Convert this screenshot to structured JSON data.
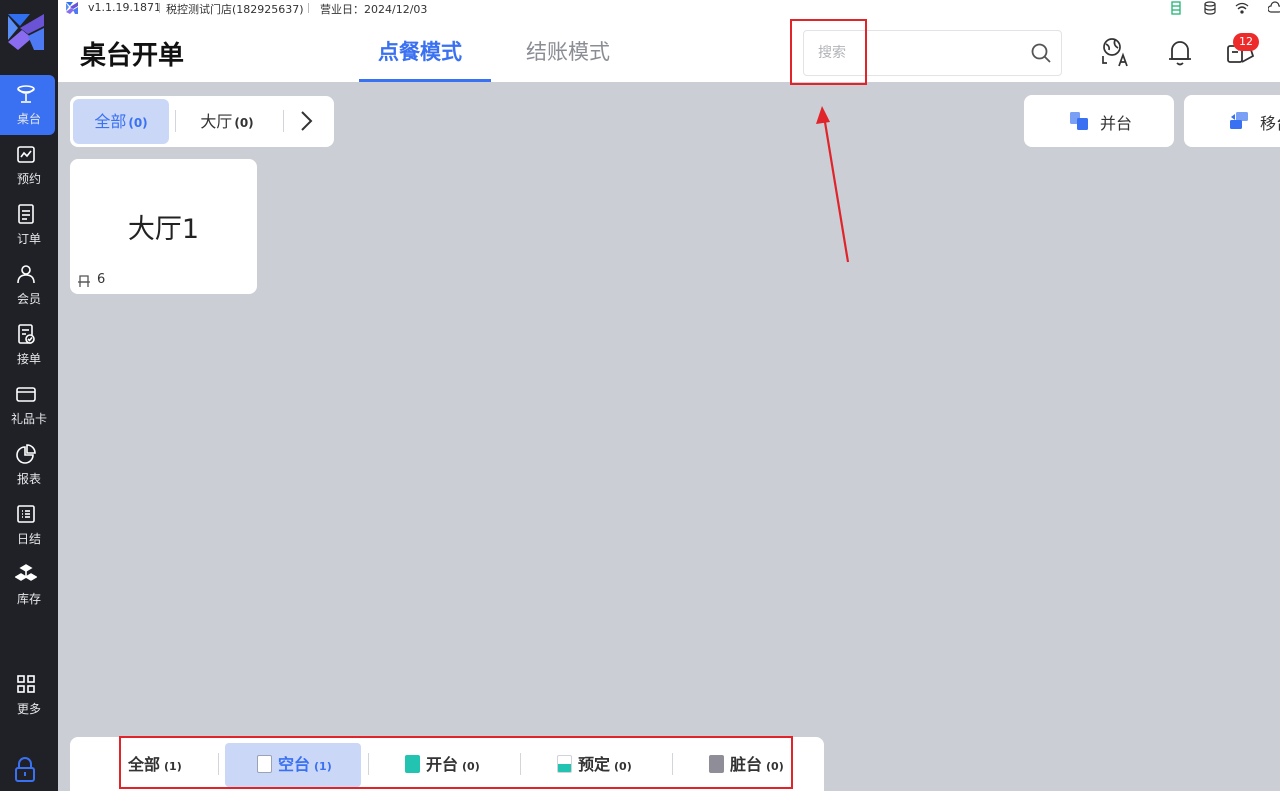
{
  "app": {
    "version": "v1.1.19.1871",
    "store": "税控测试门店(182925637)",
    "business_day": "营业日：2024/12/03"
  },
  "sidebar": {
    "items": [
      {
        "label": "桌台",
        "icon": "table-lamp-icon",
        "active": true
      },
      {
        "label": "预约",
        "icon": "calendar-chart-icon"
      },
      {
        "label": "订单",
        "icon": "order-document-icon"
      },
      {
        "label": "会员",
        "icon": "member-person-icon"
      },
      {
        "label": "接单",
        "icon": "accept-order-icon"
      },
      {
        "label": "礼品卡",
        "icon": "gift-card-icon"
      },
      {
        "label": "报表",
        "icon": "pie-chart-icon"
      },
      {
        "label": "日结",
        "icon": "daily-list-icon"
      },
      {
        "label": "库存",
        "icon": "inventory-boxes-icon"
      }
    ],
    "more_label": "更多"
  },
  "header": {
    "title": "桌台开单",
    "tabs": [
      {
        "label": "点餐模式",
        "active": true
      },
      {
        "label": "结账模式",
        "active": false
      }
    ],
    "search_placeholder": "搜索",
    "notification_badge": "12"
  },
  "area_tabs": [
    {
      "label": "全部",
      "count": "(0)",
      "active": true
    },
    {
      "label": "大厅",
      "count": "(0)",
      "active": false
    }
  ],
  "actions": [
    {
      "label": "并台",
      "icon": "merge-table-icon"
    },
    {
      "label": "移台",
      "icon": "move-table-icon"
    }
  ],
  "tables": [
    {
      "name": "大厅1",
      "seats": "6"
    }
  ],
  "status_filter": [
    {
      "label": "全部",
      "count": "(1)",
      "color": "",
      "active": false
    },
    {
      "label": "空台",
      "count": "(1)",
      "color": "#ffffff",
      "active": true
    },
    {
      "label": "开台",
      "count": "(0)",
      "color": "#22c3b0",
      "active": false
    },
    {
      "label": "预定",
      "count": "(0)",
      "color": "#22c3b0",
      "active": false
    },
    {
      "label": "脏台",
      "count": "(0)",
      "color": "#8f8e98",
      "active": false
    }
  ],
  "colors": {
    "accent": "#3a71f2",
    "sidebar_bg": "#1f2126",
    "main_bg": "#cbced5",
    "annotation_red": "#e0242a",
    "badge_red": "#ee2b2b"
  }
}
